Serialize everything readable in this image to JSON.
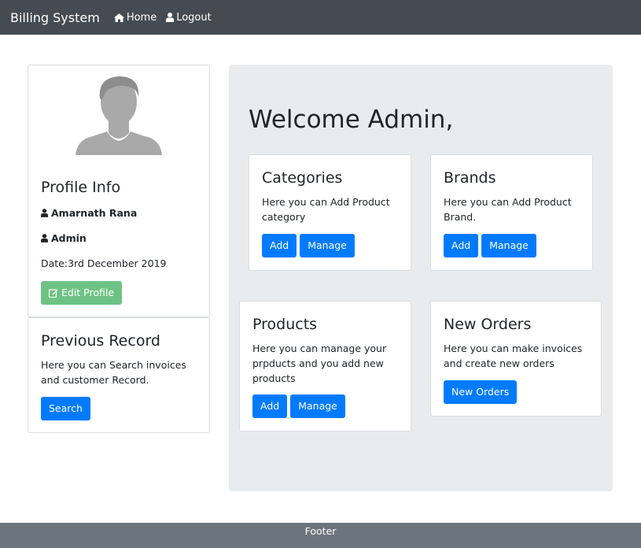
{
  "navbar": {
    "brand": "Billing System",
    "home": "Home",
    "logout": "Logout"
  },
  "profile": {
    "title": "Profile Info",
    "name": "Amarnath Rana",
    "role": "Admin",
    "date": "Date:3rd December 2019",
    "edit_label": "Edit Profile"
  },
  "record": {
    "title": "Previous Record",
    "text": "Here you can Search invoices and customer Record.",
    "button": "Search"
  },
  "welcome": "Welcome Admin,",
  "cards": {
    "categories": {
      "title": "Categories",
      "text": "Here you can Add Product category",
      "add": "Add",
      "manage": "Manage"
    },
    "brands": {
      "title": "Brands",
      "text": "Here you can Add Product Brand.",
      "add": "Add",
      "manage": "Manage"
    },
    "products": {
      "title": "Products",
      "text": "Here you can manage your prpducts and you add new products",
      "add": "Add",
      "manage": "Manage"
    },
    "orders": {
      "title": "New Orders",
      "text": "Here you can make invoices and create new orders",
      "button": "New Orders"
    }
  },
  "footer": "Footer"
}
